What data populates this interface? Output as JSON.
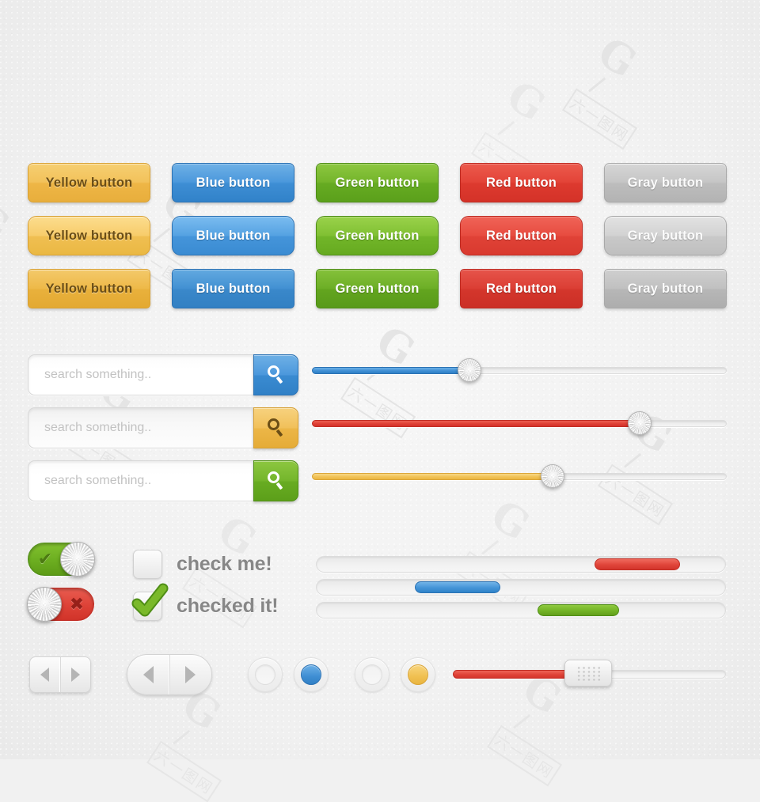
{
  "page": {
    "title": "Flat UI Elements Kit",
    "background_color": "#f1f1f1",
    "watermark_text_latin": "G",
    "watermark_text_cn": "六一图网"
  },
  "palette": {
    "yellow": "#f0bf52",
    "blue": "#4595da",
    "green": "#72b629",
    "red": "#e04237",
    "gray": "#c6c6c6",
    "text_dark": "#6b4e16",
    "text_light": "#ffffff",
    "label_gray": "#878787",
    "placeholder_gray": "#c2c2c2"
  },
  "buttons": {
    "rows": [
      {
        "radius_label": "rounded-7",
        "items": [
          {
            "label": "Yellow button",
            "color": "yellow"
          },
          {
            "label": "Blue button",
            "color": "blue"
          },
          {
            "label": "Green button",
            "color": "green"
          },
          {
            "label": "Red button",
            "color": "red"
          },
          {
            "label": "Gray button",
            "color": "gray"
          }
        ]
      },
      {
        "radius_label": "rounded-11",
        "items": [
          {
            "label": "Yellow button",
            "color": "yellow"
          },
          {
            "label": "Blue button",
            "color": "blue"
          },
          {
            "label": "Green button",
            "color": "green"
          },
          {
            "label": "Red button",
            "color": "red"
          },
          {
            "label": "Gray button",
            "color": "gray"
          }
        ]
      },
      {
        "radius_label": "rounded-5",
        "items": [
          {
            "label": "Yellow button",
            "color": "yellow"
          },
          {
            "label": "Blue button",
            "color": "blue"
          },
          {
            "label": "Green button",
            "color": "green"
          },
          {
            "label": "Red button",
            "color": "red"
          },
          {
            "label": "Gray button",
            "color": "gray"
          }
        ]
      }
    ]
  },
  "search_bars": [
    {
      "placeholder": "search something..",
      "value": "",
      "button_color": "blue",
      "icon": "search-icon"
    },
    {
      "placeholder": "search something..",
      "value": "",
      "button_color": "yellow",
      "icon": "search-icon"
    },
    {
      "placeholder": "search something..",
      "value": "",
      "button_color": "green",
      "icon": "search-icon"
    }
  ],
  "sliders": [
    {
      "color": "blue",
      "value_percent": 38
    },
    {
      "color": "red",
      "value_percent": 79
    },
    {
      "color": "yellow",
      "value_percent": 58
    }
  ],
  "toggles": [
    {
      "state": "on",
      "glyph": "✔",
      "color": "green"
    },
    {
      "state": "off",
      "glyph": "✖",
      "color": "red"
    }
  ],
  "checkboxes": [
    {
      "label": "check me!",
      "checked": false
    },
    {
      "label": "checked it!",
      "checked": true
    }
  ],
  "range_strips": [
    {
      "color": "red",
      "start_percent": 69,
      "end_percent": 90
    },
    {
      "color": "blue",
      "start_percent": 25,
      "end_percent": 46
    },
    {
      "color": "green",
      "start_percent": 55,
      "end_percent": 75
    }
  ],
  "pagers": [
    {
      "shape": "rect",
      "prev_icon": "arrow-left-icon",
      "next_icon": "arrow-right-icon"
    },
    {
      "shape": "pill",
      "prev_icon": "arrow-left-icon",
      "next_icon": "arrow-right-icon"
    }
  ],
  "radios": [
    {
      "selected": false,
      "color": "none"
    },
    {
      "selected": true,
      "color": "blue"
    },
    {
      "selected": false,
      "color": "none"
    },
    {
      "selected": true,
      "color": "yellow"
    }
  ],
  "grip_slider": {
    "color": "red",
    "value_percent": 46,
    "handle_icon": "grip-dots-icon"
  }
}
